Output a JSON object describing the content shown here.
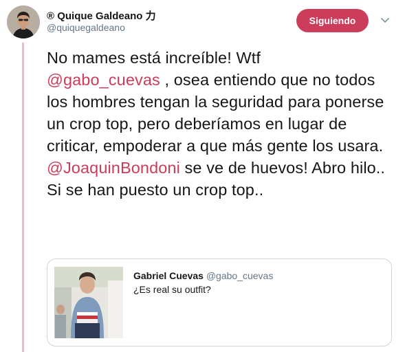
{
  "author": {
    "display_name": "® Quique Galdeano 力",
    "handle": "@quiquegaldeano"
  },
  "follow_button": {
    "label": "Siguiendo",
    "color": "#cc3c5b"
  },
  "tweet": {
    "line1": "No mames está increíble! Wtf",
    "mention1": "@gabo_cuevas",
    "line2a": " , osea entiendo que no todos los hombres tengan la seguridad para ponerse un crop top, pero deberíamos en lugar de criticar, empoderar a que más gente los usara.",
    "mention2": "@JoaquinBondoni",
    "line3": " se ve de huevos! Abro hilo.. Si se han puesto un crop top.."
  },
  "quoted_tweet": {
    "name": "Gabriel Cuevas",
    "handle": "@gabo_cuevas",
    "text": "¿Es real su outfit?"
  },
  "icons": {
    "caret": "chevron-down-icon"
  },
  "colors": {
    "mention": "#cc3c5b",
    "thread_line": "#e1bfcb"
  }
}
